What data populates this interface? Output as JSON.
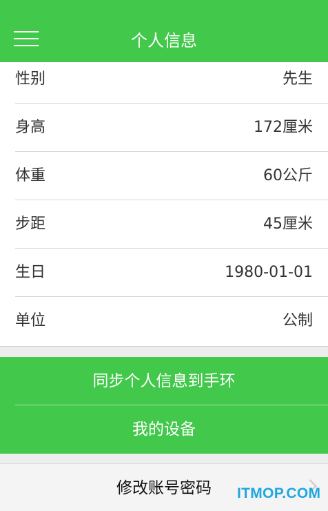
{
  "header": {
    "title": "个人信息",
    "menu_icon": "hamburger-menu-icon",
    "background_color": "#42c84a"
  },
  "info": {
    "rows": [
      {
        "label": "性别",
        "value": "先生"
      },
      {
        "label": "身高",
        "value": "172厘米"
      },
      {
        "label": "体重",
        "value": "60公斤"
      },
      {
        "label": "步距",
        "value": "45厘米"
      },
      {
        "label": "生日",
        "value": "1980-01-01"
      },
      {
        "label": "单位",
        "value": "公制"
      }
    ]
  },
  "actions": {
    "sync_label": "同步个人信息到手环",
    "devices_label": "我的设备",
    "change_password_label": "修改账号密码"
  },
  "watermark": {
    "text": "ITMOP.COM",
    "color": "#1ea7df"
  }
}
